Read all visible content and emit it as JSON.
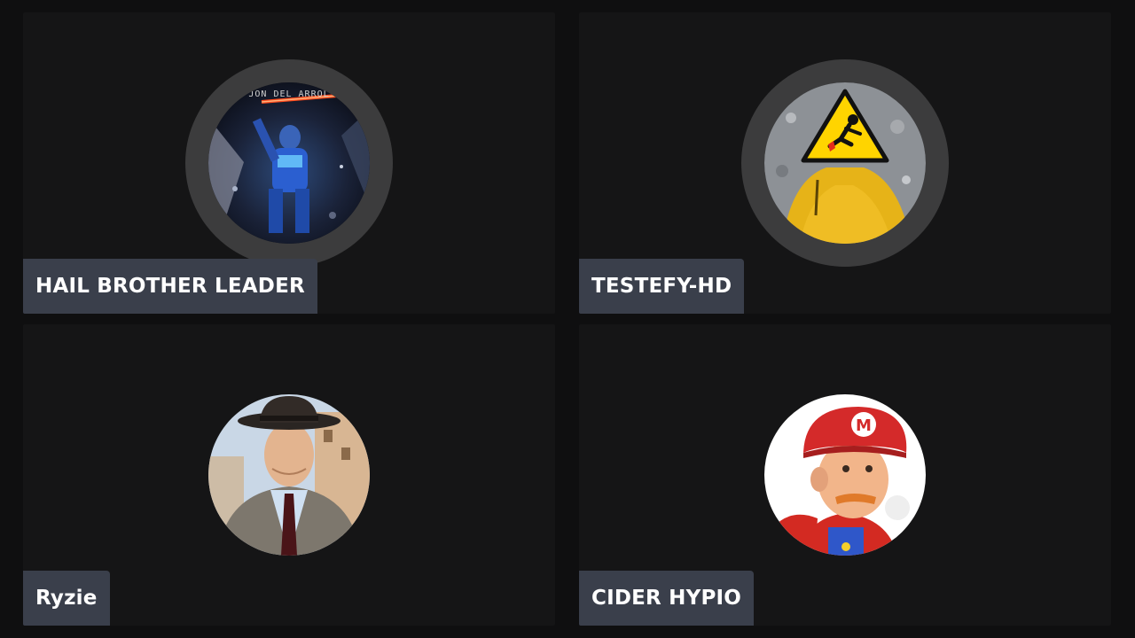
{
  "participants": [
    {
      "name": "HAIL BROTHER LEADER",
      "avatar_icon": "armored-robot-avatar",
      "avatar_caption": "JON DEL ARROL",
      "speaking": true
    },
    {
      "name": "TESTEFY-HD",
      "avatar_icon": "caution-sign-raincoat-avatar",
      "speaking": true
    },
    {
      "name": "Ryzie",
      "avatar_icon": "man-in-fedora-avatar",
      "speaking": false
    },
    {
      "name": "CIDER HYPIO",
      "avatar_icon": "plumber-cap-avatar",
      "speaking": false
    }
  ],
  "colors": {
    "background": "#0f0f10",
    "tile": "#151516",
    "name_tag": "#3a3f4b",
    "speaking_ring": "#3c3c3d",
    "name_text": "#ffffff"
  }
}
